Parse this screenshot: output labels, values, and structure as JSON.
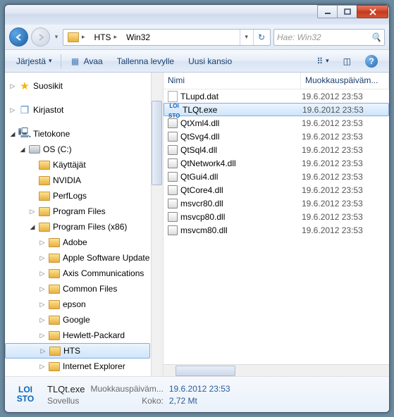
{
  "breadcrumb": {
    "seg1": "HTS",
    "seg2": "Win32"
  },
  "search": {
    "placeholder": "Hae: Win32"
  },
  "toolbar": {
    "organize": "Järjestä",
    "open": "Avaa",
    "save_to_disk": "Tallenna levylle",
    "new_folder": "Uusi kansio"
  },
  "tree": {
    "favorites": "Suosikit",
    "libraries": "Kirjastot",
    "computer": "Tietokone",
    "drive": "OS (C:)",
    "items": [
      "Käyttäjät",
      "NVIDIA",
      "PerfLogs",
      "Program Files",
      "Program Files (x86)",
      "Adobe",
      "Apple Software Update",
      "Axis Communications",
      "Common Files",
      "epson",
      "Google",
      "Hewlett-Packard",
      "HTS",
      "Internet Explorer"
    ]
  },
  "list": {
    "col_name": "Nimi",
    "col_mod": "Muokkauspäiväm...",
    "rows": [
      {
        "name": "TLupd.dat",
        "date": "19.6.2012 23:53",
        "type": "file"
      },
      {
        "name": "TLQt.exe",
        "date": "19.6.2012 23:53",
        "type": "app",
        "sel": true
      },
      {
        "name": "QtXml4.dll",
        "date": "19.6.2012 23:53",
        "type": "dll"
      },
      {
        "name": "QtSvg4.dll",
        "date": "19.6.2012 23:53",
        "type": "dll"
      },
      {
        "name": "QtSql4.dll",
        "date": "19.6.2012 23:53",
        "type": "dll"
      },
      {
        "name": "QtNetwork4.dll",
        "date": "19.6.2012 23:53",
        "type": "dll"
      },
      {
        "name": "QtGui4.dll",
        "date": "19.6.2012 23:53",
        "type": "dll"
      },
      {
        "name": "QtCore4.dll",
        "date": "19.6.2012 23:53",
        "type": "dll"
      },
      {
        "name": "msvcr80.dll",
        "date": "19.6.2012 23:53",
        "type": "dll"
      },
      {
        "name": "msvcp80.dll",
        "date": "19.6.2012 23:53",
        "type": "dll"
      },
      {
        "name": "msvcm80.dll",
        "date": "19.6.2012 23:53",
        "type": "dll"
      }
    ]
  },
  "details": {
    "name": "TLQt.exe",
    "mod_label": "Muokkauspäiväm...",
    "mod_value": "19.6.2012 23:53",
    "type": "Sovellus",
    "size_label": "Koko:",
    "size_value": "2,72 Mt",
    "logo_top": "LOI",
    "logo_bot": "STO"
  }
}
